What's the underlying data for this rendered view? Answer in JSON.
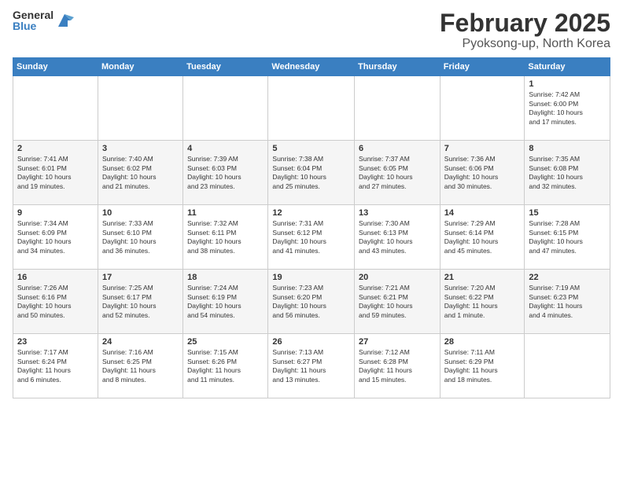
{
  "logo": {
    "general": "General",
    "blue": "Blue"
  },
  "title": "February 2025",
  "location": "Pyoksong-up, North Korea",
  "days_header": [
    "Sunday",
    "Monday",
    "Tuesday",
    "Wednesday",
    "Thursday",
    "Friday",
    "Saturday"
  ],
  "weeks": [
    [
      {
        "day": "",
        "info": ""
      },
      {
        "day": "",
        "info": ""
      },
      {
        "day": "",
        "info": ""
      },
      {
        "day": "",
        "info": ""
      },
      {
        "day": "",
        "info": ""
      },
      {
        "day": "",
        "info": ""
      },
      {
        "day": "1",
        "info": "Sunrise: 7:42 AM\nSunset: 6:00 PM\nDaylight: 10 hours\nand 17 minutes."
      }
    ],
    [
      {
        "day": "2",
        "info": "Sunrise: 7:41 AM\nSunset: 6:01 PM\nDaylight: 10 hours\nand 19 minutes."
      },
      {
        "day": "3",
        "info": "Sunrise: 7:40 AM\nSunset: 6:02 PM\nDaylight: 10 hours\nand 21 minutes."
      },
      {
        "day": "4",
        "info": "Sunrise: 7:39 AM\nSunset: 6:03 PM\nDaylight: 10 hours\nand 23 minutes."
      },
      {
        "day": "5",
        "info": "Sunrise: 7:38 AM\nSunset: 6:04 PM\nDaylight: 10 hours\nand 25 minutes."
      },
      {
        "day": "6",
        "info": "Sunrise: 7:37 AM\nSunset: 6:05 PM\nDaylight: 10 hours\nand 27 minutes."
      },
      {
        "day": "7",
        "info": "Sunrise: 7:36 AM\nSunset: 6:06 PM\nDaylight: 10 hours\nand 30 minutes."
      },
      {
        "day": "8",
        "info": "Sunrise: 7:35 AM\nSunset: 6:08 PM\nDaylight: 10 hours\nand 32 minutes."
      }
    ],
    [
      {
        "day": "9",
        "info": "Sunrise: 7:34 AM\nSunset: 6:09 PM\nDaylight: 10 hours\nand 34 minutes."
      },
      {
        "day": "10",
        "info": "Sunrise: 7:33 AM\nSunset: 6:10 PM\nDaylight: 10 hours\nand 36 minutes."
      },
      {
        "day": "11",
        "info": "Sunrise: 7:32 AM\nSunset: 6:11 PM\nDaylight: 10 hours\nand 38 minutes."
      },
      {
        "day": "12",
        "info": "Sunrise: 7:31 AM\nSunset: 6:12 PM\nDaylight: 10 hours\nand 41 minutes."
      },
      {
        "day": "13",
        "info": "Sunrise: 7:30 AM\nSunset: 6:13 PM\nDaylight: 10 hours\nand 43 minutes."
      },
      {
        "day": "14",
        "info": "Sunrise: 7:29 AM\nSunset: 6:14 PM\nDaylight: 10 hours\nand 45 minutes."
      },
      {
        "day": "15",
        "info": "Sunrise: 7:28 AM\nSunset: 6:15 PM\nDaylight: 10 hours\nand 47 minutes."
      }
    ],
    [
      {
        "day": "16",
        "info": "Sunrise: 7:26 AM\nSunset: 6:16 PM\nDaylight: 10 hours\nand 50 minutes."
      },
      {
        "day": "17",
        "info": "Sunrise: 7:25 AM\nSunset: 6:17 PM\nDaylight: 10 hours\nand 52 minutes."
      },
      {
        "day": "18",
        "info": "Sunrise: 7:24 AM\nSunset: 6:19 PM\nDaylight: 10 hours\nand 54 minutes."
      },
      {
        "day": "19",
        "info": "Sunrise: 7:23 AM\nSunset: 6:20 PM\nDaylight: 10 hours\nand 56 minutes."
      },
      {
        "day": "20",
        "info": "Sunrise: 7:21 AM\nSunset: 6:21 PM\nDaylight: 10 hours\nand 59 minutes."
      },
      {
        "day": "21",
        "info": "Sunrise: 7:20 AM\nSunset: 6:22 PM\nDaylight: 11 hours\nand 1 minute."
      },
      {
        "day": "22",
        "info": "Sunrise: 7:19 AM\nSunset: 6:23 PM\nDaylight: 11 hours\nand 4 minutes."
      }
    ],
    [
      {
        "day": "23",
        "info": "Sunrise: 7:17 AM\nSunset: 6:24 PM\nDaylight: 11 hours\nand 6 minutes."
      },
      {
        "day": "24",
        "info": "Sunrise: 7:16 AM\nSunset: 6:25 PM\nDaylight: 11 hours\nand 8 minutes."
      },
      {
        "day": "25",
        "info": "Sunrise: 7:15 AM\nSunset: 6:26 PM\nDaylight: 11 hours\nand 11 minutes."
      },
      {
        "day": "26",
        "info": "Sunrise: 7:13 AM\nSunset: 6:27 PM\nDaylight: 11 hours\nand 13 minutes."
      },
      {
        "day": "27",
        "info": "Sunrise: 7:12 AM\nSunset: 6:28 PM\nDaylight: 11 hours\nand 15 minutes."
      },
      {
        "day": "28",
        "info": "Sunrise: 7:11 AM\nSunset: 6:29 PM\nDaylight: 11 hours\nand 18 minutes."
      },
      {
        "day": "",
        "info": ""
      }
    ]
  ]
}
